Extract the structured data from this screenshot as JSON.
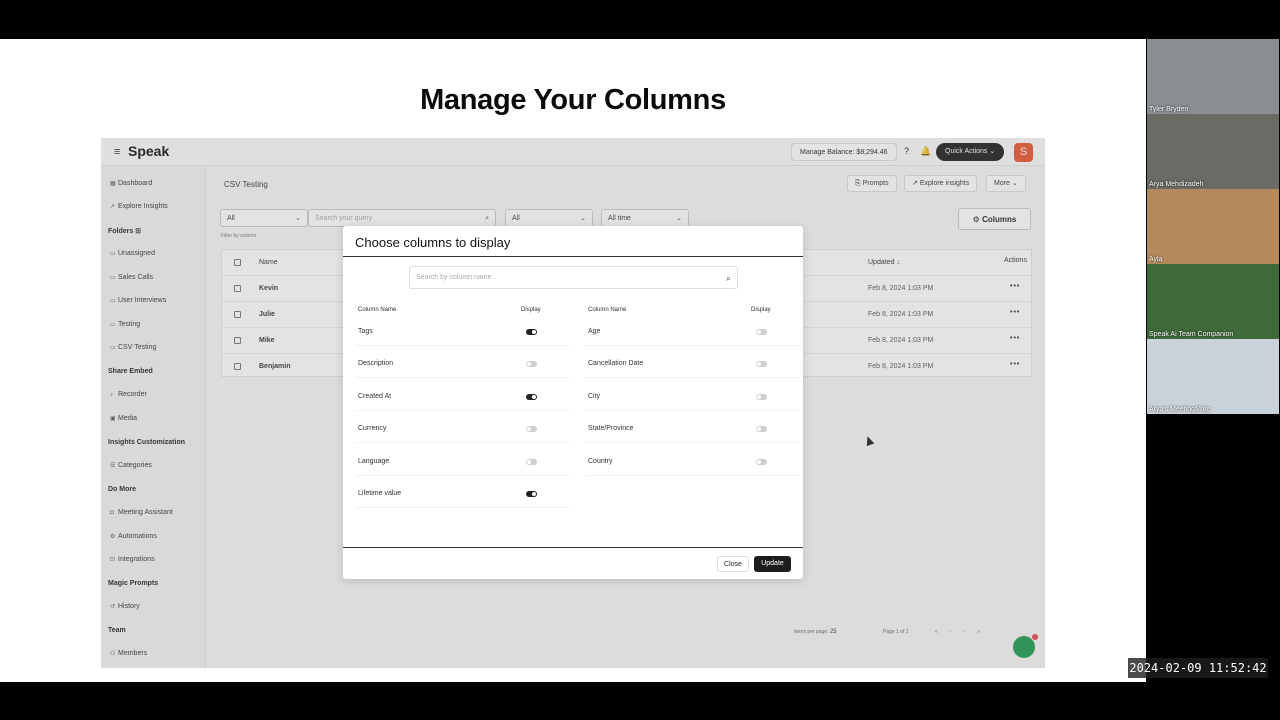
{
  "slide": {
    "title": "Manage Your Columns"
  },
  "app": {
    "logo": "Speak",
    "balance": "Manage Balance: $8,294.46",
    "quick_actions": "Quick Actions ⌄",
    "avatar_initial": "S",
    "sidebar": {
      "dashboard": "Dashboard",
      "explore": "Explore Insights",
      "folders": "Folders",
      "unassigned": "Unassigned",
      "sales": "Sales Calls",
      "interviews": "User Interviews",
      "testing": "Testing",
      "csv": "CSV Testing",
      "share_embed": "Share Embed",
      "recorder": "Recorder",
      "media": "Media",
      "insights_custom": "Insights Customization",
      "categories": "Categories",
      "do_more": "Do More",
      "meeting_assistant": "Meeting Assistant",
      "automations": "Automations",
      "integrations": "Integrations",
      "magic_prompts": "Magic Prompts",
      "history": "History",
      "team": "Team",
      "members": "Members"
    },
    "main": {
      "title": "CSV Testing",
      "prompts": "Prompts",
      "explore": "Explore insights",
      "more": "More ⌄",
      "filter_all": "All",
      "search_placeholder": "Search your query",
      "filter_all2": "All",
      "filter_time": "All time",
      "filter_hint": "Filter by column",
      "columns_btn": "Columns"
    },
    "table": {
      "head_name": "Name",
      "head_updated": "Updated ↓",
      "head_actions": "Actions",
      "rows": [
        {
          "name": "Kevin",
          "updated": "Feb 8, 2024 1:03 PM"
        },
        {
          "name": "Julie",
          "updated": "Feb 8, 2024 1:03 PM"
        },
        {
          "name": "Mike",
          "updated": "Feb 8, 2024 1:03 PM"
        },
        {
          "name": "Benjamin",
          "updated": "Feb 8, 2024 1:03 PM"
        }
      ],
      "actions_glyph": "•••"
    },
    "pager": {
      "items_label": "items per page:",
      "items_value": "25",
      "page_label": "Page 1 of 1"
    }
  },
  "modal": {
    "title": "Choose columns to display",
    "search_placeholder": "Search by column name",
    "col_name_head": "Column Name",
    "display_head": "Display",
    "left": [
      {
        "label": "Tags",
        "on": true
      },
      {
        "label": "Description",
        "on": false
      },
      {
        "label": "Created At",
        "on": true
      },
      {
        "label": "Currency",
        "on": false
      },
      {
        "label": "Language",
        "on": false
      },
      {
        "label": "Lifetime value",
        "on": true
      }
    ],
    "right": [
      {
        "label": "Age",
        "on": false
      },
      {
        "label": "Cancellation Date",
        "on": false
      },
      {
        "label": "City",
        "on": false
      },
      {
        "label": "State/Province",
        "on": false
      },
      {
        "label": "Country",
        "on": false
      }
    ],
    "close": "Close",
    "update": "Update"
  },
  "participants": [
    {
      "name": "Tyler Bryden",
      "bg": "#8a8f94"
    },
    {
      "name": "Arya Mehdizadeh",
      "bg": "#6b6a64"
    },
    {
      "name": "Ayla",
      "bg": "#b48a5c"
    },
    {
      "name": "Speak Ai Team Companion",
      "bg": "#3f6b3a"
    },
    {
      "name": "Arya's MeetingMate",
      "bg": "#c9d2d8"
    }
  ],
  "timestamp": "2024-02-09  11:52:42"
}
